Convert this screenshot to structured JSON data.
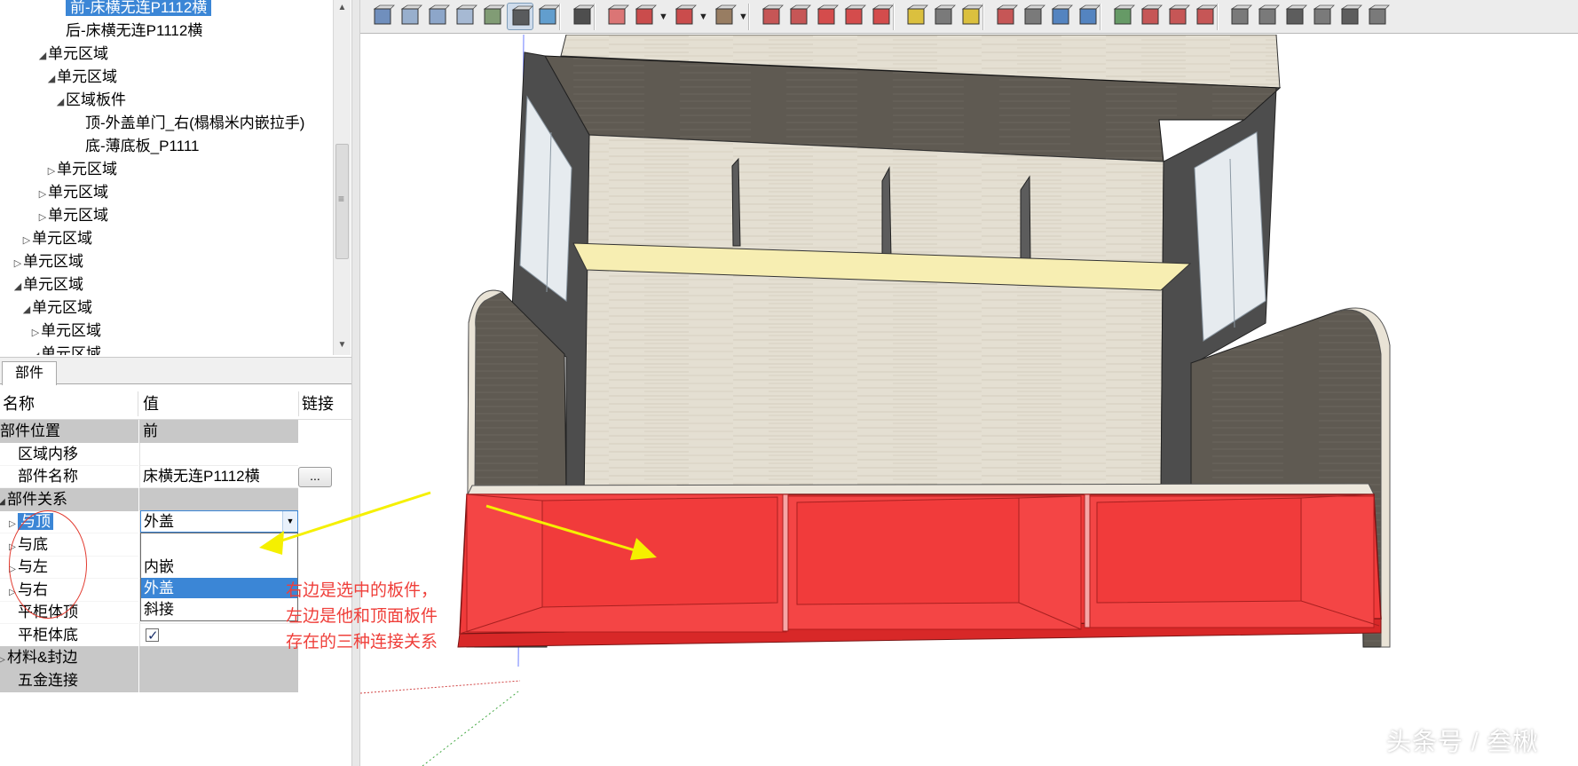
{
  "tree": {
    "items": [
      {
        "label": "前-床横无连P1112横",
        "arrow": "",
        "selected": true
      },
      {
        "label": "后-床横无连P1112横",
        "arrow": "",
        "selected": false
      },
      {
        "label": "单元区域",
        "arrow": "◢",
        "selected": false
      },
      {
        "label": "单元区域",
        "arrow": "◢",
        "selected": false
      },
      {
        "label": "区域板件",
        "arrow": "◢",
        "selected": false
      },
      {
        "label": "顶-外盖单门_右(榻榻米内嵌拉手)",
        "arrow": "",
        "selected": false
      },
      {
        "label": "底-薄底板_P1111",
        "arrow": "",
        "selected": false
      },
      {
        "label": "单元区域",
        "arrow": "▷",
        "selected": false
      },
      {
        "label": "单元区域",
        "arrow": "▷",
        "selected": false
      },
      {
        "label": "单元区域",
        "arrow": "▷",
        "selected": false
      },
      {
        "label": "单元区域",
        "arrow": "▷",
        "selected": false
      },
      {
        "label": "单元区域",
        "arrow": "▷",
        "selected": false
      },
      {
        "label": "单元区域",
        "arrow": "◢",
        "selected": false
      },
      {
        "label": "单元区域",
        "arrow": "◢",
        "selected": false
      },
      {
        "label": "单元区域",
        "arrow": "▷",
        "selected": false
      },
      {
        "label": "单元区域",
        "arrow": "◢",
        "selected": false
      }
    ]
  },
  "props": {
    "tab_label": "部件",
    "headers": {
      "name": "名称",
      "value": "值",
      "link": "链接"
    },
    "rows": [
      {
        "name": "部件位置",
        "value": "前",
        "group": true
      },
      {
        "name": "区域内移",
        "value": ""
      },
      {
        "name": "部件名称",
        "value": "床横无连P1112横",
        "button": "..."
      },
      {
        "name": "部件关系",
        "value": "",
        "group": true
      },
      {
        "name": "与顶",
        "value": "外盖",
        "selected": true
      },
      {
        "name": "与底",
        "value": ""
      },
      {
        "name": "与左",
        "value": ""
      },
      {
        "name": "与右",
        "value": ""
      },
      {
        "name": "平柜体顶",
        "value": ""
      },
      {
        "name": "平柜体底",
        "value": "",
        "checked": true
      },
      {
        "name": "材料&封边",
        "value": "",
        "group": true
      },
      {
        "name": "五金连接",
        "value": "",
        "group": true
      }
    ],
    "dropdown_options": [
      "",
      "内嵌",
      "外盖",
      "斜接"
    ],
    "dropdown_highlighted": "外盖"
  },
  "toolbar": {
    "icons": [
      "components-icon",
      "paste-in-place-icon",
      "box-icon",
      "iso-icon",
      "front-icon",
      "layers-icon",
      "material-icon",
      "select-icon",
      "eraser-icon",
      "pencil-icon",
      "arc-icon",
      "rectangle-icon",
      "push-pull-icon",
      "follow-me-icon",
      "move-icon",
      "rotate-icon",
      "scale-icon",
      "tape-measure-icon",
      "text-icon",
      "paint-bucket-icon",
      "orbit-icon",
      "pan-icon",
      "zoom-icon",
      "zoom-extents-icon",
      "map-icon",
      "export-icon",
      "import-icon",
      "share-icon",
      "house-1-icon",
      "house-2-icon",
      "house-3-icon",
      "house-4-icon",
      "house-5-icon",
      "house-6-icon"
    ]
  },
  "annotation": {
    "lines": [
      "右边是选中的板件，",
      "左边是他和顶面板件",
      "存在的三种连接关系"
    ],
    "color": "#ef3f3a"
  },
  "watermark": "头条号 / 叁楸",
  "colors": {
    "selection": "#3b86d6",
    "selected_panel": "#f03a3a",
    "arrow": "#f5f000"
  }
}
